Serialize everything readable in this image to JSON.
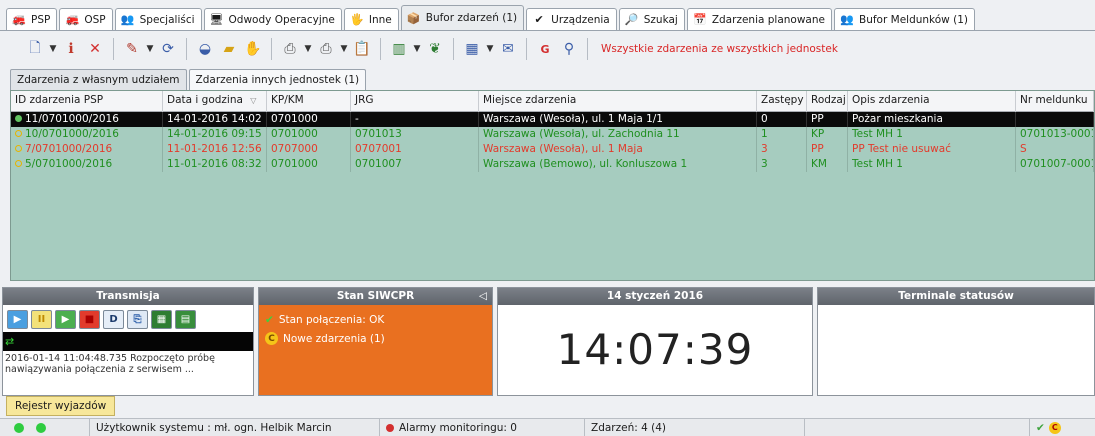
{
  "tabs": [
    {
      "label": "PSP",
      "icon": "ambulance-icon",
      "glyph": "🚒",
      "active": false
    },
    {
      "label": "OSP",
      "icon": "fire-truck-icon",
      "glyph": "🚒",
      "active": false
    },
    {
      "label": "Specjaliści",
      "icon": "people-icon",
      "glyph": "👥",
      "active": false
    },
    {
      "label": "Odwody Operacyjne",
      "icon": "monitor-icon",
      "glyph": "🖥",
      "active": false
    },
    {
      "label": "Inne",
      "icon": "hand-icon",
      "glyph": "🖐",
      "active": false
    },
    {
      "label": "Bufor zdarzeń (1)",
      "icon": "box-icon",
      "glyph": "📦",
      "active": true
    },
    {
      "label": "Urządzenia",
      "icon": "check-icon",
      "glyph": "✔",
      "active": false
    },
    {
      "label": "Szukaj",
      "icon": "magnifier-icon",
      "glyph": "🔎",
      "active": false
    },
    {
      "label": "Zdarzenia planowane",
      "icon": "calendar-icon",
      "glyph": "📅",
      "active": false
    },
    {
      "label": "Bufor Meldunków (1)",
      "icon": "people-icon",
      "glyph": "👥",
      "active": false
    }
  ],
  "toolbar": {
    "alert_text": "Wszystkie zdarzenia ze wszystkich jednostek"
  },
  "subtabs": [
    {
      "label": "Zdarzenia z własnym udziałem",
      "active": true
    },
    {
      "label": "Zdarzenia innych jednostek (1)",
      "active": false
    }
  ],
  "grid": {
    "columns": [
      "ID zdarzenia PSP",
      "Data i godzina",
      "KP/KM",
      "JRG",
      "Miejsce zdarzenia",
      "Zastępy",
      "Rodzaj",
      "Opis zdarzenia",
      "Nr meldunku"
    ],
    "sort_indicator": "▽",
    "rows": [
      {
        "id": "11/0701000/2016",
        "date": "14-01-2016 14:02",
        "kpkm": "0701000",
        "jrg": "-",
        "place": "Warszawa (Wesoła), ul. 1 Maja 1/1",
        "zastepy": "0",
        "rodzaj": "PP",
        "opis": "Pożar mieszkania",
        "nr": "",
        "style": "selected"
      },
      {
        "id": "10/0701000/2016",
        "date": "14-01-2016 09:15",
        "kpkm": "0701000",
        "jrg": "0701013",
        "place": "Warszawa (Wesoła), ul. Zachodnia 11",
        "zastepy": "1",
        "rodzaj": "KP",
        "opis": "Test MH 1",
        "nr": "0701013-0001",
        "style": "green"
      },
      {
        "id": "7/0701000/2016",
        "date": "11-01-2016 12:56",
        "kpkm": "0707000",
        "jrg": "0707001",
        "place": "Warszawa (Wesoła), ul. 1 Maja",
        "zastepy": "3",
        "rodzaj": "PP",
        "opis": "PP Test nie usuwać",
        "nr": "S",
        "style": "red"
      },
      {
        "id": "5/0701000/2016",
        "date": "11-01-2016 08:32",
        "kpkm": "0701000",
        "jrg": "0701007",
        "place": "Warszawa (Bemowo), ul. Konluszowa 1",
        "zastepy": "3",
        "rodzaj": "KM",
        "opis": "Test MH 1",
        "nr": "0701007-0001",
        "style": "green"
      }
    ]
  },
  "panels": {
    "transmisja": {
      "title": "Transmisja",
      "buttons": [
        "▶",
        "II",
        "▶",
        "■",
        "D",
        "⎘",
        "▦",
        "▤"
      ],
      "log": "2016-01-14 11:04:48.735 Rozpoczęto próbę nawiązywania połączenia z serwisem ..."
    },
    "siwcpr": {
      "title": "Stan SIWCPR",
      "connection": "Stan połączenia: OK",
      "new_events": "Nowe zdarzenia (1)"
    },
    "clock": {
      "date": "14 styczeń 2016",
      "time": "14:07:39"
    },
    "terminals": {
      "title": "Terminale statusów"
    }
  },
  "rejestr_button": "Rejestr wyjazdów",
  "status": {
    "user": "Użytkownik systemu : mł. ogn. Helbik Marcin",
    "alarms": "Alarmy monitoringu: 0",
    "count": "Zdarzeń: 4 (4)"
  },
  "colors": {
    "grid_bg": "#a6ccbf",
    "selected_row": "#0a0a0a",
    "green_text": "#1f8f1f",
    "red_text": "#e23b2c",
    "siwcpr_bg": "#e97020",
    "rejestr_bg": "#f7e79a"
  }
}
